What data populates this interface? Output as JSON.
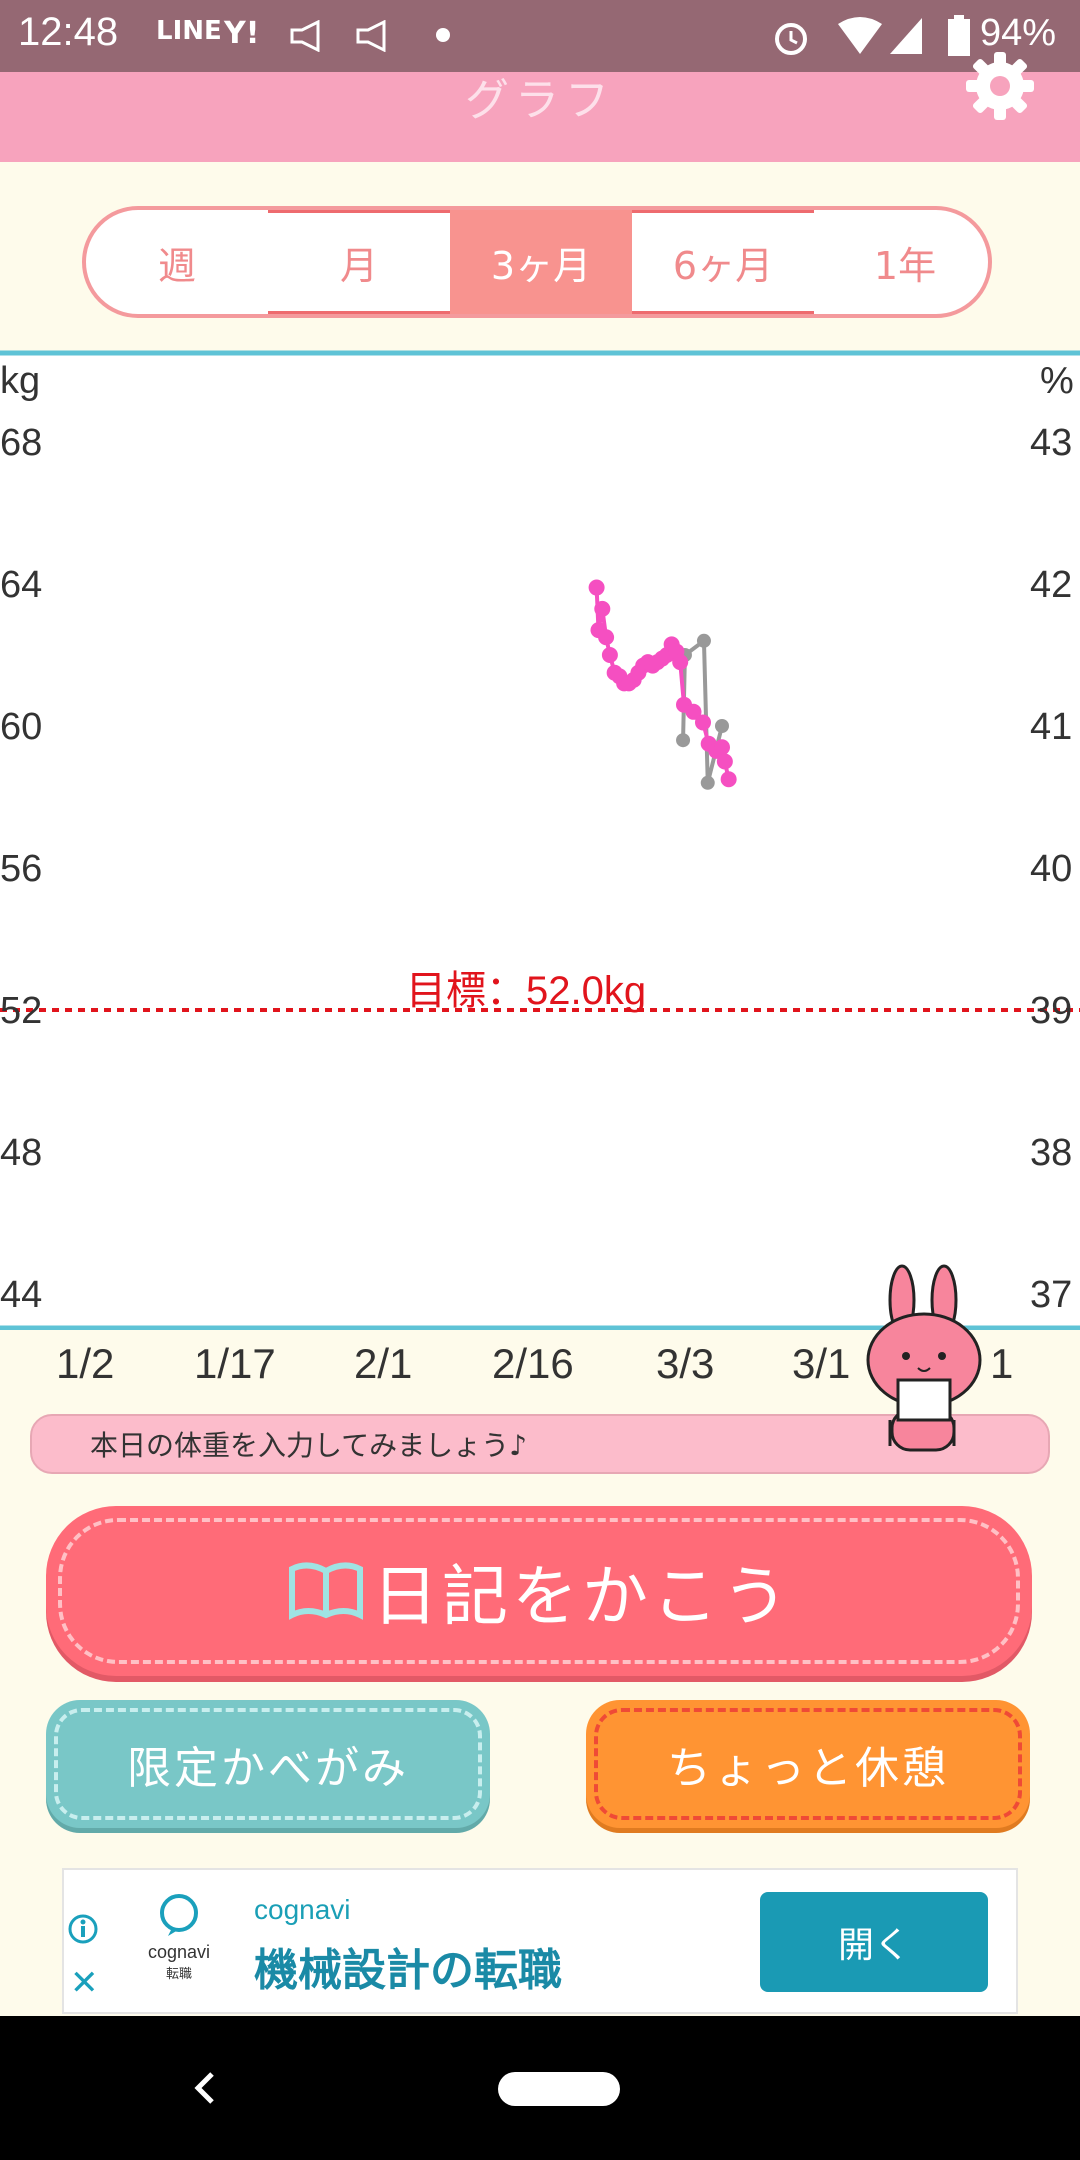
{
  "status_bar": {
    "time": "12:48",
    "notifications": [
      "LINE",
      "Y!"
    ],
    "battery": "94%"
  },
  "header": {
    "title": "グラフ",
    "settings_icon": "gear-icon"
  },
  "period_tabs": [
    {
      "label": "週",
      "active": false
    },
    {
      "label": "月",
      "active": false
    },
    {
      "label": "3ヶ月",
      "active": true
    },
    {
      "label": "6ヶ月",
      "active": false
    },
    {
      "label": "1年",
      "active": false
    }
  ],
  "chart": {
    "left_unit": "kg",
    "right_unit": "%",
    "left_ticks": [
      "68",
      "64",
      "60",
      "56",
      "52",
      "48",
      "44"
    ],
    "right_ticks": [
      "43",
      "42",
      "41",
      "40",
      "39",
      "38",
      "37"
    ],
    "x_ticks": [
      "1/2",
      "1/17",
      "2/1",
      "2/16",
      "3/3",
      "3/1",
      "1"
    ],
    "goal_label": "目標：52.0kg",
    "colors": {
      "weight": "#f54fc1",
      "body_fat": "#999999",
      "goal": "#e1141c",
      "axis": "#5fc3d6"
    }
  },
  "chart_data": {
    "type": "line",
    "ylim": [
      44,
      68
    ],
    "y2lim": [
      37,
      43
    ],
    "goal": 52.0,
    "series": [
      {
        "axis": "left",
        "points": [
          [
            62.8,
            63.9
          ],
          [
            63.0,
            62.7
          ],
          [
            63.4,
            63.3
          ],
          [
            63.8,
            62.5
          ],
          [
            64.2,
            62.0
          ],
          [
            64.7,
            61.5
          ],
          [
            65.2,
            61.4
          ],
          [
            65.7,
            61.2
          ],
          [
            66.2,
            61.2
          ],
          [
            66.7,
            61.3
          ],
          [
            67.2,
            61.5
          ],
          [
            67.7,
            61.7
          ],
          [
            68.2,
            61.8
          ],
          [
            68.7,
            61.7
          ],
          [
            69.2,
            61.8
          ],
          [
            69.7,
            61.9
          ],
          [
            70.2,
            62.0
          ],
          [
            70.7,
            62.3
          ],
          [
            71.2,
            62.1
          ],
          [
            71.6,
            61.8
          ],
          [
            72.0,
            60.6
          ],
          [
            73.0,
            60.4
          ],
          [
            74.0,
            60.1
          ],
          [
            74.6,
            59.5
          ],
          [
            75.4,
            59.3
          ],
          [
            76.0,
            59.4
          ],
          [
            76.3,
            59.0
          ],
          [
            76.7,
            58.5
          ]
        ]
      },
      {
        "axis": "right",
        "points": [
          [
            71.9,
            40.9
          ],
          [
            72.1,
            41.5
          ],
          [
            74.1,
            41.6
          ],
          [
            74.5,
            40.6
          ],
          [
            76.0,
            41.0
          ]
        ]
      }
    ]
  },
  "hint": "本日の体重を入力してみましょう♪",
  "buttons": {
    "diary": "日記をかこう",
    "wallpaper": "限定かべがみ",
    "rest": "ちょっと休憩"
  },
  "ad": {
    "brand": "cognavi",
    "logo_text": "cognavi",
    "logo_sub": "転職",
    "headline": "機械設計の転職",
    "cta": "開く"
  }
}
